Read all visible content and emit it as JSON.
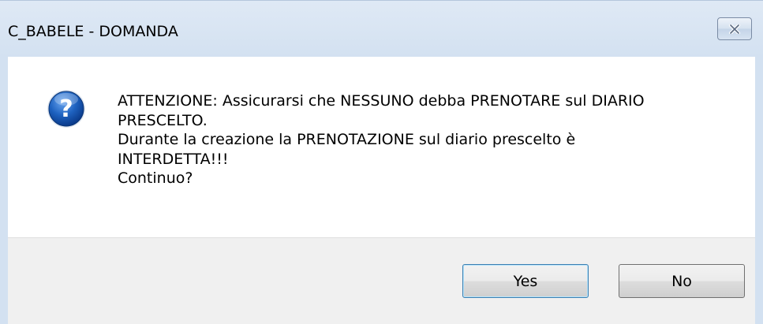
{
  "window": {
    "title": "C_BABELE - DOMANDA",
    "close_icon": "close-icon"
  },
  "dialog": {
    "icon": "question-icon",
    "message_lines": [
      "ATTENZIONE: Assicurarsi che NESSUNO debba PRENOTARE sul DIARIO",
      "PRESCELTO.",
      "Durante la creazione la PRENOTAZIONE sul diario prescelto è",
      "INTERDETTA!!!",
      "Continuo?"
    ]
  },
  "buttons": {
    "yes_label": "Yes",
    "no_label": "No"
  },
  "colors": {
    "titlebar": "#d3e1f1",
    "button_bar": "#f0f0f0",
    "icon_blue": "#1e62c0"
  }
}
